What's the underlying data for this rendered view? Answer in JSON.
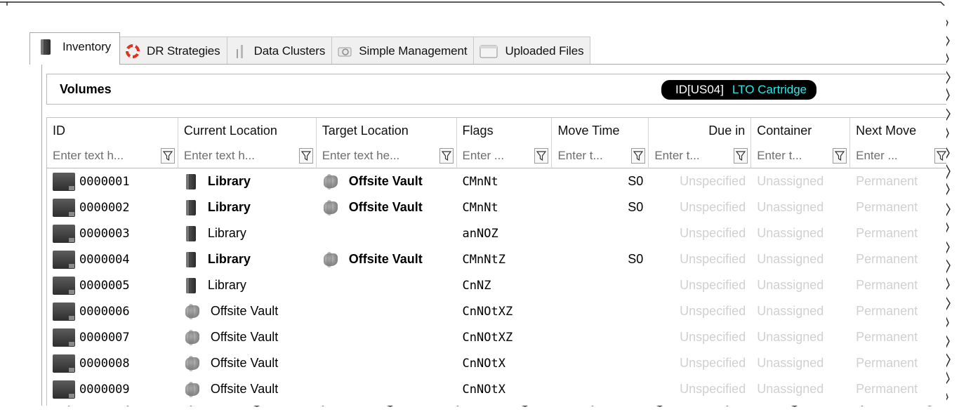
{
  "tabs": [
    {
      "label": "Inventory",
      "icon": "book-icon",
      "active": true
    },
    {
      "label": "DR Strategies",
      "icon": "lifebuoy-icon",
      "active": false
    },
    {
      "label": "Data Clusters",
      "icon": "cluster-icon",
      "active": false
    },
    {
      "label": "Simple Management",
      "icon": "camera-icon",
      "active": false
    },
    {
      "label": "Uploaded Files",
      "icon": "window-icon",
      "active": false
    }
  ],
  "header": {
    "title": "Volumes",
    "badge_id": "ID[US04]",
    "badge_type": "LTO Cartridge",
    "badge_type_color": "#2ee6e6"
  },
  "columns": [
    "ID",
    "Current Location",
    "Target Location",
    "Flags",
    "Move Time",
    "Due in",
    "Container",
    "Next Move"
  ],
  "filters": [
    "Enter text h...",
    "Enter text h...",
    "Enter text he...",
    "Enter ...",
    "Enter t...",
    "Enter t...",
    "Enter t...",
    "Enter ..."
  ],
  "rows": [
    {
      "id": "0000001",
      "current": "Library",
      "current_bold": true,
      "current_icon": "book-icon",
      "target": "Offsite Vault",
      "flags": "CMnNt",
      "move_time": "S0",
      "due_in": "Unspecified",
      "container": "Unassigned",
      "next_move": "Permanent"
    },
    {
      "id": "0000002",
      "current": "Library",
      "current_bold": true,
      "current_icon": "book-icon",
      "target": "Offsite Vault",
      "flags": "CMnNt",
      "move_time": "S0",
      "due_in": "Unspecified",
      "container": "Unassigned",
      "next_move": "Permanent"
    },
    {
      "id": "0000003",
      "current": "Library",
      "current_bold": false,
      "current_icon": "book-icon",
      "target": "",
      "flags": "anNOZ",
      "move_time": "",
      "due_in": "Unspecified",
      "container": "Unassigned",
      "next_move": "Permanent"
    },
    {
      "id": "0000004",
      "current": "Library",
      "current_bold": true,
      "current_icon": "book-icon",
      "target": "Offsite Vault",
      "flags": "CMnNtZ",
      "move_time": "S0",
      "due_in": "Unspecified",
      "container": "Unassigned",
      "next_move": "Permanent"
    },
    {
      "id": "0000005",
      "current": "Library",
      "current_bold": false,
      "current_icon": "book-icon",
      "target": "",
      "flags": "CnNZ",
      "move_time": "",
      "due_in": "Unspecified",
      "container": "Unassigned",
      "next_move": "Permanent"
    },
    {
      "id": "0000006",
      "current": "Offsite Vault",
      "current_bold": false,
      "current_icon": "vault-icon",
      "target": "",
      "flags": "CnNOtXZ",
      "move_time": "",
      "due_in": "Unspecified",
      "container": "Unassigned",
      "next_move": "Permanent"
    },
    {
      "id": "0000007",
      "current": "Offsite Vault",
      "current_bold": false,
      "current_icon": "vault-icon",
      "target": "",
      "flags": "CnNOtXZ",
      "move_time": "",
      "due_in": "Unspecified",
      "container": "Unassigned",
      "next_move": "Permanent"
    },
    {
      "id": "0000008",
      "current": "Offsite Vault",
      "current_bold": false,
      "current_icon": "vault-icon",
      "target": "",
      "flags": "CnNOtX",
      "move_time": "",
      "due_in": "Unspecified",
      "container": "Unassigned",
      "next_move": "Permanent"
    },
    {
      "id": "0000009",
      "current": "Offsite Vault",
      "current_bold": false,
      "current_icon": "vault-icon",
      "target": "",
      "flags": "CnNOtX",
      "move_time": "",
      "due_in": "Unspecified",
      "container": "Unassigned",
      "next_move": "Permanent"
    }
  ]
}
